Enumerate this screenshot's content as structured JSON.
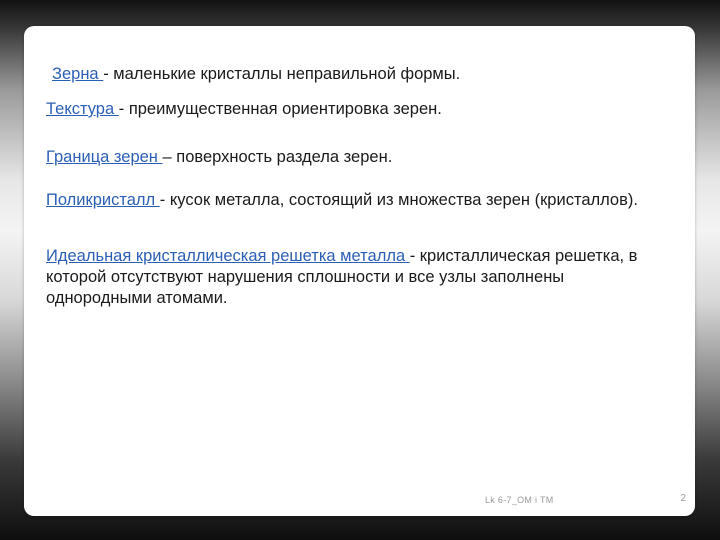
{
  "definitions": [
    {
      "term": "Зерна ",
      "text": "- маленькие кристаллы неправильной формы."
    },
    {
      "term": "Текстура ",
      "text": "- преимущественная ориентировка зерен."
    },
    {
      "term": "Граница зерен ",
      "text": "– поверхность раздела зерен."
    },
    {
      "term": "Поликристалл ",
      "text": "- кусок металла, состоящий из множества зерен (кристаллов)."
    },
    {
      "term": "Идеальная кристаллическая решетка металла ",
      "text": "- кристаллическая решетка, в которой отсутствуют нарушения сплошности и все узлы заполнены однородными атомами."
    }
  ],
  "footer": {
    "label": "Lk 6-7_OM i TM",
    "page": "2"
  }
}
